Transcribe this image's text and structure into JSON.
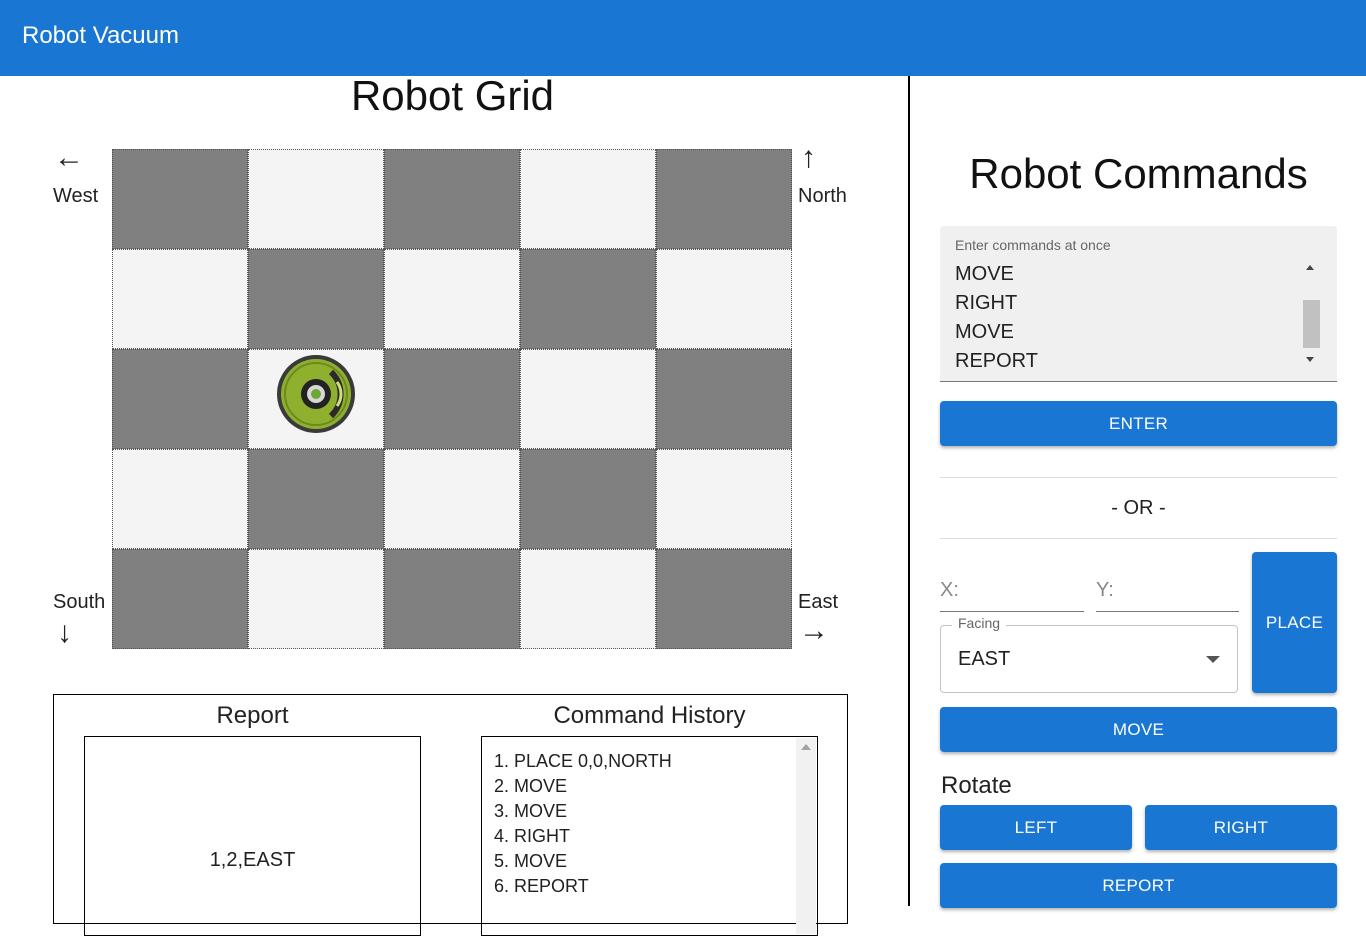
{
  "appbar": {
    "title": "Robot Vacuum"
  },
  "grid": {
    "title": "Robot Grid",
    "columns": 5,
    "rows": 5,
    "robot_position": {
      "col": 1,
      "row": 2
    },
    "colors": {
      "dark": "#808080",
      "light": "#f4f4f4"
    }
  },
  "compass": {
    "west": {
      "label": "West",
      "arrow": "←"
    },
    "north": {
      "label": "North",
      "arrow": "↑"
    },
    "south": {
      "label": "South",
      "arrow": "↓"
    },
    "east": {
      "label": "East",
      "arrow": "→"
    }
  },
  "report": {
    "title": "Report",
    "value": "1,2,EAST"
  },
  "history": {
    "title": "Command History",
    "items": [
      "1. PLACE 0,0,NORTH",
      "2. MOVE",
      "3. MOVE",
      "4. RIGHT",
      "5. MOVE",
      "6. REPORT"
    ]
  },
  "commands": {
    "title": "Robot Commands",
    "textarea_label": "Enter commands at once",
    "textarea_lines": [
      "MOVE",
      "RIGHT",
      "MOVE",
      "REPORT"
    ],
    "enter_label": "ENTER",
    "or_label": "- OR -",
    "x_placeholder": "X:",
    "y_placeholder": "Y:",
    "facing_label": "Facing",
    "facing_value": "EAST",
    "place_label": "PLACE",
    "move_label": "MOVE",
    "rotate_label": "Rotate",
    "left_label": "LEFT",
    "right_label": "RIGHT",
    "report_label": "REPORT"
  },
  "theme": {
    "primary": "#1976d2"
  }
}
